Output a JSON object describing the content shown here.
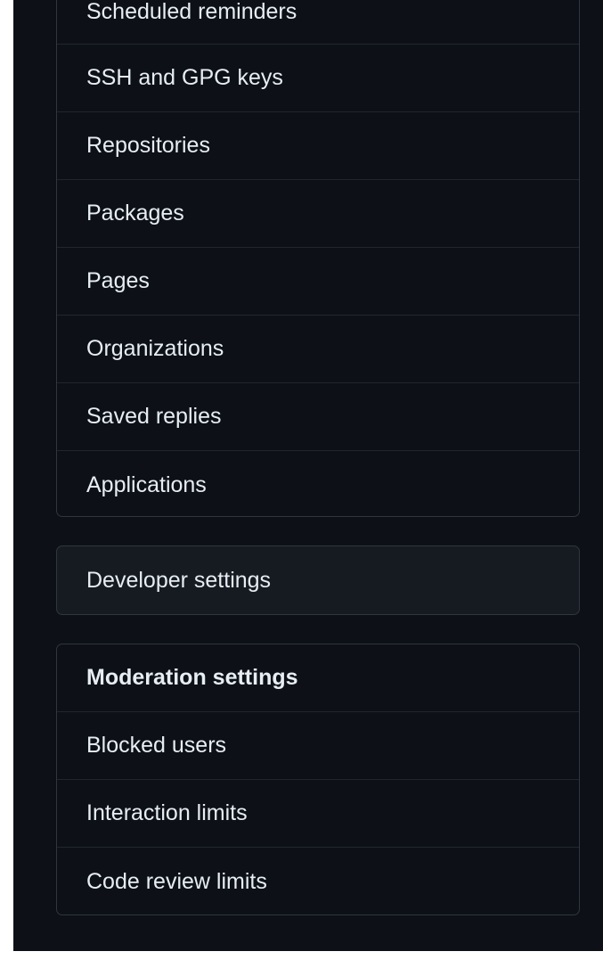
{
  "sidebar": {
    "main_items": [
      {
        "label": "Scheduled reminders"
      },
      {
        "label": "SSH and GPG keys"
      },
      {
        "label": "Repositories"
      },
      {
        "label": "Packages"
      },
      {
        "label": "Pages"
      },
      {
        "label": "Organizations"
      },
      {
        "label": "Saved replies"
      },
      {
        "label": "Applications"
      }
    ],
    "developer": {
      "label": "Developer settings"
    },
    "moderation": {
      "header": "Moderation settings",
      "items": [
        {
          "label": "Blocked users"
        },
        {
          "label": "Interaction limits"
        },
        {
          "label": "Code review limits"
        }
      ]
    }
  },
  "colors": {
    "background": "#0d1117",
    "border": "#30363d",
    "text": "#e6edf3",
    "selected_bg": "#161b22"
  }
}
